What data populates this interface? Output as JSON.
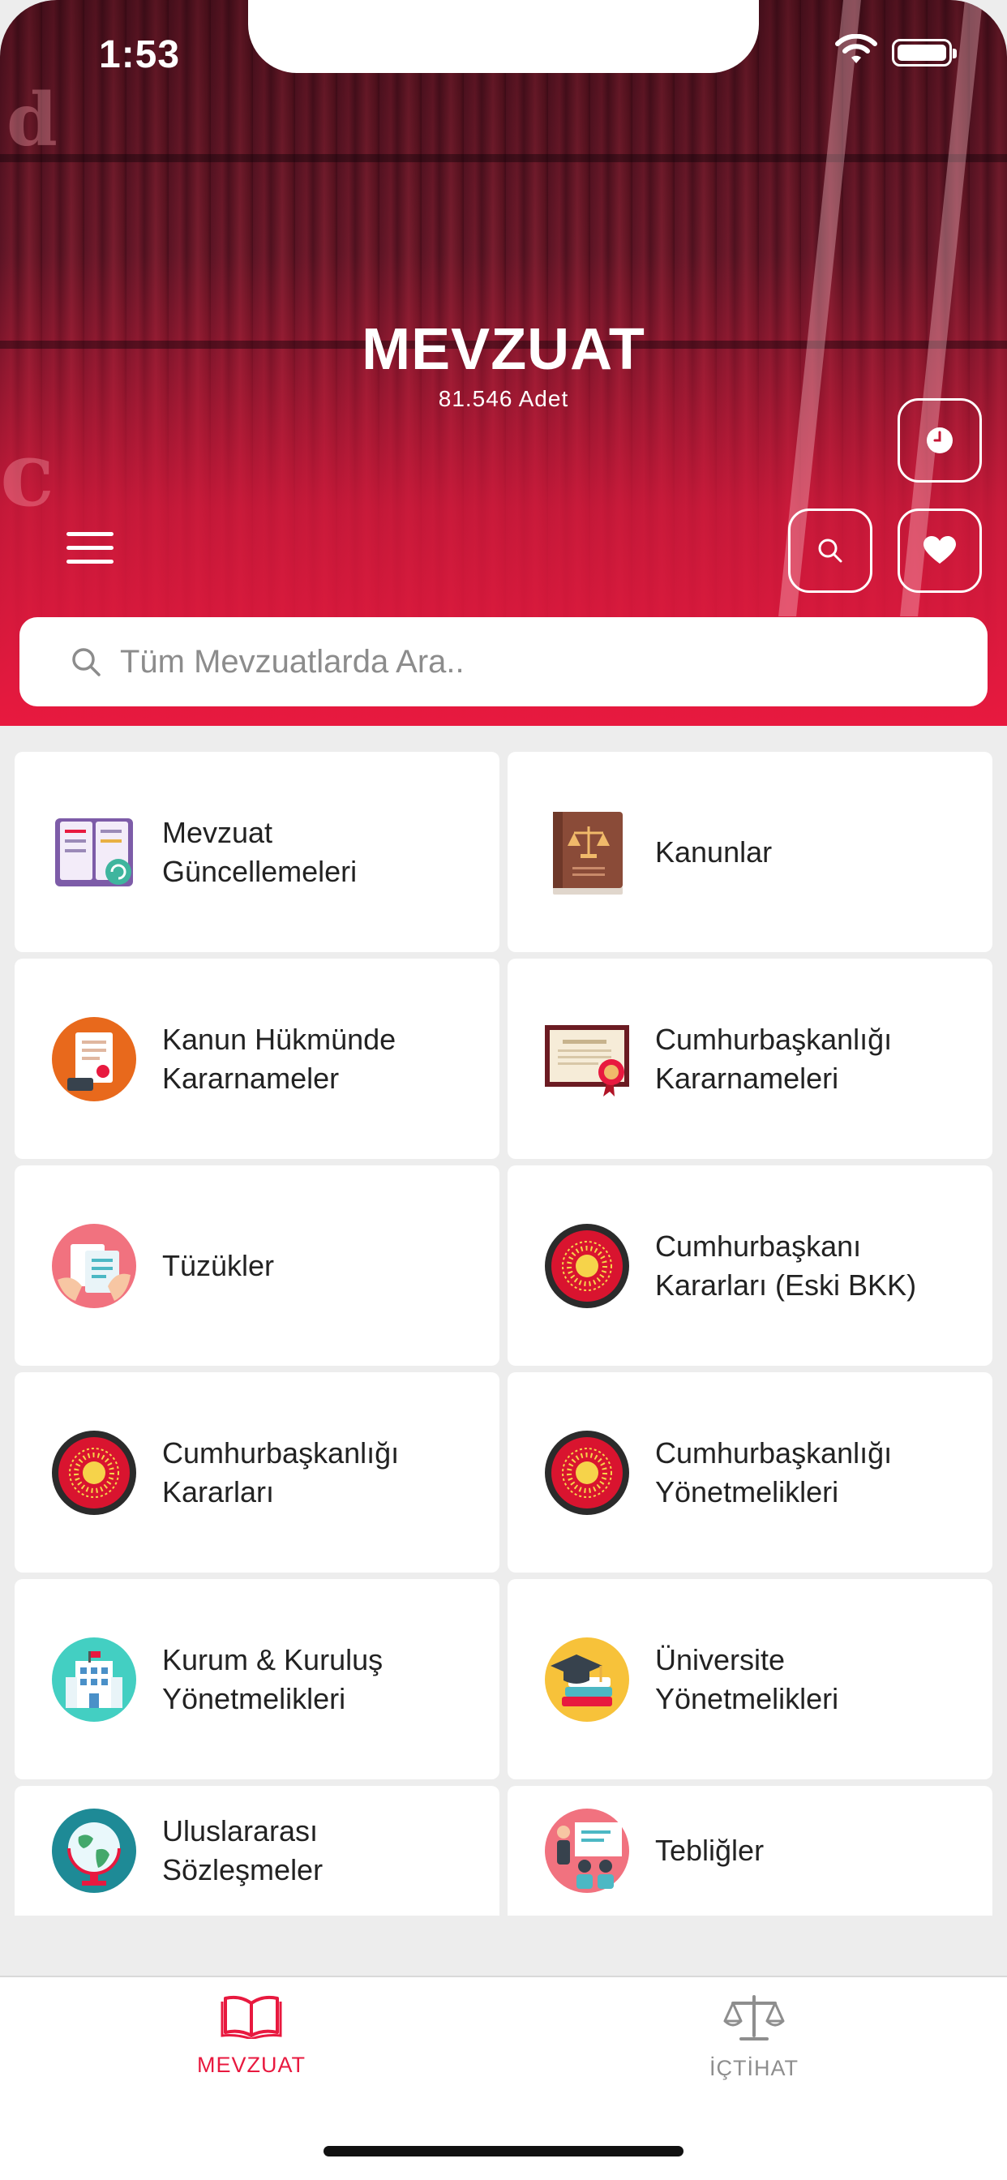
{
  "status_bar": {
    "time": "1:53"
  },
  "header": {
    "title": "MEVZUAT",
    "count": "81.546 Adet"
  },
  "search": {
    "placeholder": "Tüm Mevzuatlarda Ara.."
  },
  "colors": {
    "accent": "#e8193f",
    "inactive": "#8e8e8e"
  },
  "categories": [
    {
      "label": "Mevzuat\nGüncellemeleri",
      "icon": "book-update-icon"
    },
    {
      "label": "Kanunlar",
      "icon": "law-book-icon"
    },
    {
      "label": "Kanun Hükmünde\nKararnameler",
      "icon": "decree-document-icon"
    },
    {
      "label": "Cumhurbaşkanlığı\nKararnameleri",
      "icon": "certificate-seal-icon"
    },
    {
      "label": "Tüzükler",
      "icon": "regulation-documents-icon"
    },
    {
      "label": "Cumhurbaşkanı\nKararları (Eski BKK)",
      "icon": "presidential-seal-icon"
    },
    {
      "label": "Cumhurbaşkanlığı\nKararları",
      "icon": "presidential-seal-icon"
    },
    {
      "label": "Cumhurbaşkanlığı\nYönetmelikleri",
      "icon": "presidential-seal-icon"
    },
    {
      "label": "Kurum & Kuruluş\nYönetmelikleri",
      "icon": "institution-building-icon"
    },
    {
      "label": "Üniversite\nYönetmelikleri",
      "icon": "graduation-cap-icon"
    },
    {
      "label": "Uluslararası\nSözleşmeler",
      "icon": "globe-icon"
    },
    {
      "label": "Tebliğler",
      "icon": "presentation-icon"
    }
  ],
  "tabs": [
    {
      "label": "MEVZUAT",
      "icon": "open-book-icon",
      "active": true
    },
    {
      "label": "İÇTİHAT",
      "icon": "scales-icon",
      "active": false
    }
  ]
}
